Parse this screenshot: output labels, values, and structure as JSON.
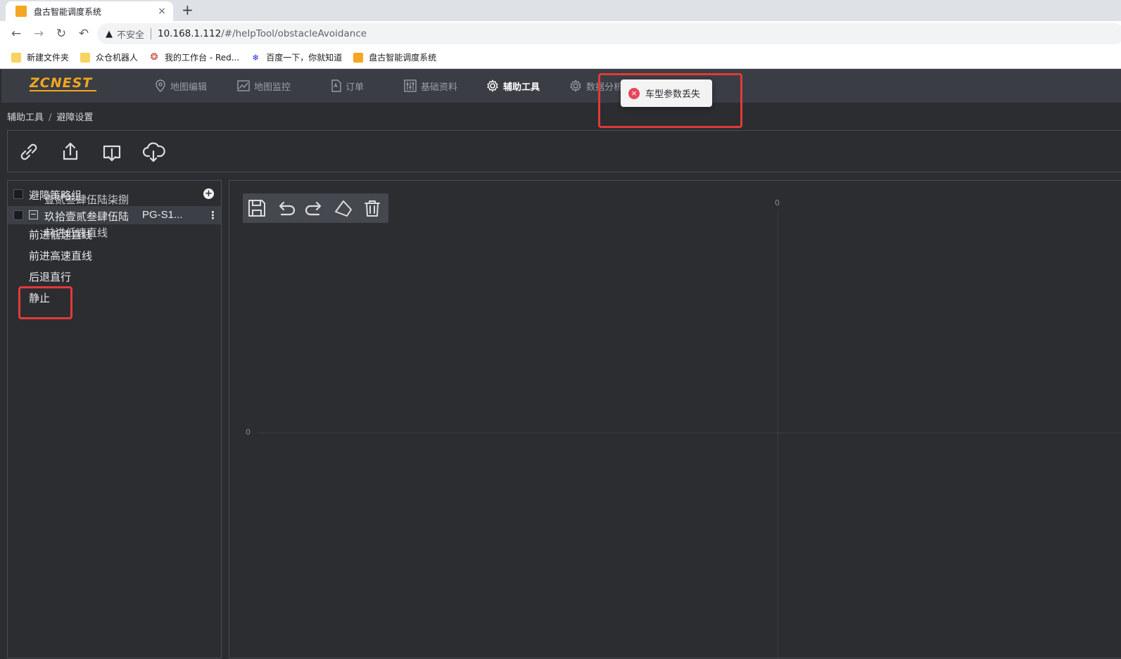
{
  "browser": {
    "tab_title": "盘古智能调度系统",
    "tab_close": "×",
    "new_tab": "+",
    "not_secure": "不安全",
    "url_host": "10.168.1.112",
    "url_path": "/#/helpTool/obstacleAvoidance",
    "bookmarks": [
      {
        "label": "新建文件夹",
        "icon": "folder-icon"
      },
      {
        "label": "众仓机器人",
        "icon": "folder-icon"
      },
      {
        "label": "我的工作台 - Red...",
        "icon": "redmine-icon"
      },
      {
        "label": "百度一下，你就知道",
        "icon": "baidu-icon"
      },
      {
        "label": "盘古智能调度系统",
        "icon": "app-favicon"
      }
    ]
  },
  "app": {
    "logo": "ZCNEST",
    "nav": [
      {
        "label": "地图编辑",
        "icon": "map-pin-icon"
      },
      {
        "label": "地图监控",
        "icon": "chart-line-icon"
      },
      {
        "label": "订单",
        "icon": "document-icon"
      },
      {
        "label": "基础资料",
        "icon": "sliders-icon"
      },
      {
        "label": "辅助工具",
        "icon": "gear-icon",
        "active": true
      },
      {
        "label": "数据分析",
        "icon": "gear-icon"
      }
    ],
    "breadcrumb": [
      "辅助工具",
      "避障设置"
    ]
  },
  "toolbar": {
    "buttons": [
      "link-icon",
      "export-icon",
      "import-icon",
      "cloud-download-icon"
    ]
  },
  "tree": {
    "root_label": "避障策略组",
    "root_overlap_text": "壹贰叁肆伍陆柒捌",
    "group_label": "玖拾壹贰叁肆伍陆",
    "group_code": "PG-S1...",
    "group_overlap_text": "前进低速直线",
    "children": [
      "前进低速直线",
      "前进高速直线",
      "后退直行",
      "静止"
    ]
  },
  "canvas": {
    "tools": [
      "save-icon",
      "undo-icon",
      "redo-icon",
      "polygon-icon",
      "trash-icon"
    ],
    "x_axis_label": "0",
    "y_axis_label": "0"
  },
  "toast": {
    "type": "error",
    "message": "车型参数丢失"
  },
  "colors": {
    "app_bg": "#2b2d31",
    "nav_bg": "#3a3d43",
    "accent": "#f5a623",
    "highlight": "#e23a3a",
    "error": "#e6465a"
  }
}
